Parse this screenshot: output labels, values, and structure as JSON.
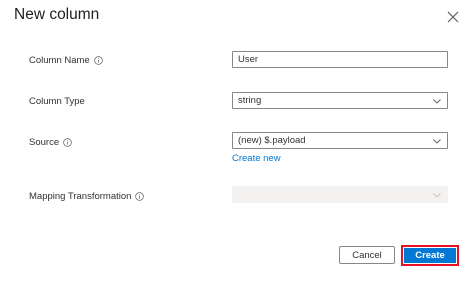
{
  "dialog": {
    "title": "New column",
    "close_icon": "close-icon"
  },
  "fields": {
    "column_name": {
      "label": "Column Name",
      "value": "User"
    },
    "column_type": {
      "label": "Column Type",
      "value": "string"
    },
    "source": {
      "label": "Source",
      "value": "(new) $.payload",
      "link": "Create new"
    },
    "mapping_transformation": {
      "label": "Mapping Transformation",
      "value": ""
    }
  },
  "buttons": {
    "cancel": "Cancel",
    "create": "Create"
  },
  "colors": {
    "accent": "#0078d4",
    "highlight": "#e81123"
  }
}
